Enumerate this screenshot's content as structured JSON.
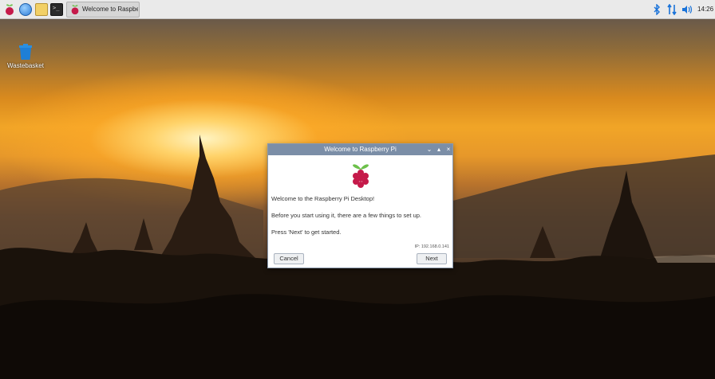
{
  "taskbar": {
    "icons": [
      "raspberry-menu-icon",
      "web-browser-icon",
      "file-manager-icon",
      "terminal-icon"
    ],
    "terminal_glyph": ">_",
    "task_button_label": "Welcome to Raspberr...",
    "tray_icons": [
      "bluetooth-icon",
      "network-icon",
      "volume-icon"
    ],
    "clock": "14:26"
  },
  "desktop": {
    "icons": [
      {
        "label": "Wastebasket",
        "icon": "wastebasket-icon"
      }
    ]
  },
  "dialog": {
    "title": "Welcome to Raspberry Pi",
    "window_buttons": {
      "minimize": "⌄",
      "maximize": "▴",
      "close": "×"
    },
    "line1": "Welcome to the Raspberry Pi Desktop!",
    "line2": "Before you start using it, there are a few things to set up.",
    "line3": "Press 'Next' to get started.",
    "ip_address": "IP: 192.168.0.141",
    "cancel_label": "Cancel",
    "next_label": "Next"
  },
  "colors": {
    "titlebar": "#7b8ea7",
    "taskbar": "#eaeaea",
    "raspberry": "#c51a4a",
    "leaf": "#6cc04a"
  }
}
